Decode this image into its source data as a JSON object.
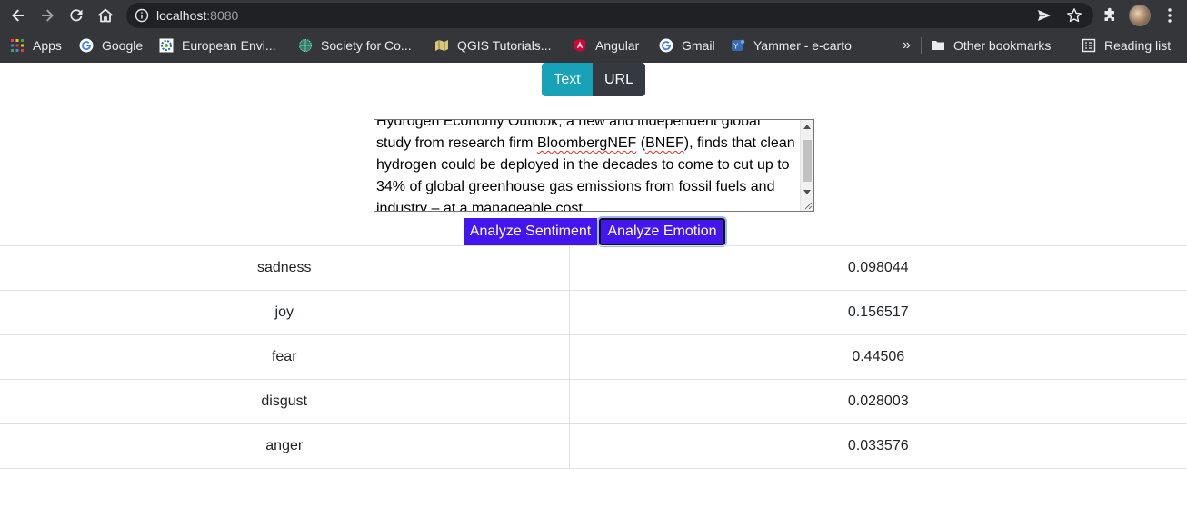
{
  "browser": {
    "url_host": "localhost",
    "url_port": ":8080",
    "bookmarks": [
      {
        "label": "Apps",
        "icon": "apps-grid-icon"
      },
      {
        "label": "Google",
        "icon": "google-icon"
      },
      {
        "label": "European Envi...",
        "icon": "eea-icon"
      },
      {
        "label": "Society for Co...",
        "icon": "globe-icon"
      },
      {
        "label": "QGIS Tutorials...",
        "icon": "qgis-icon"
      },
      {
        "label": "Angular",
        "icon": "angular-icon"
      },
      {
        "label": "Gmail",
        "icon": "google-icon"
      },
      {
        "label": "Yammer - e-carto",
        "icon": "yammer-icon"
      }
    ],
    "overflow": "»",
    "other_bookmarks": "Other bookmarks",
    "reading_list": "Reading list"
  },
  "tabs": {
    "text_label": "Text",
    "url_label": "URL"
  },
  "input": {
    "line_top": "Hydrogen Economy Outlook, a new and independent global",
    "line_2a": "study from research firm ",
    "word_bnef_long": "BloombergNEF",
    "line_2b": " (",
    "word_bnef": "BNEF",
    "line_2c": "), finds that clean",
    "line_3": "hydrogen could be deployed in the decades to come to cut up to",
    "line_4": "34% of global greenhouse gas emissions from fossil fuels and",
    "line_5": "industry – at a manageable cost."
  },
  "actions": {
    "sentiment_label": "Analyze Sentiment",
    "emotion_label": "Analyze Emotion"
  },
  "results": [
    {
      "emotion": "sadness",
      "score": "0.098044"
    },
    {
      "emotion": "joy",
      "score": "0.156517"
    },
    {
      "emotion": "fear",
      "score": "0.44506"
    },
    {
      "emotion": "disgust",
      "score": "0.028003"
    },
    {
      "emotion": "anger",
      "score": "0.033576"
    }
  ],
  "colors": {
    "text_tab": "#17a2b8",
    "url_tab": "#343a40",
    "action_button": "#4316f0"
  }
}
